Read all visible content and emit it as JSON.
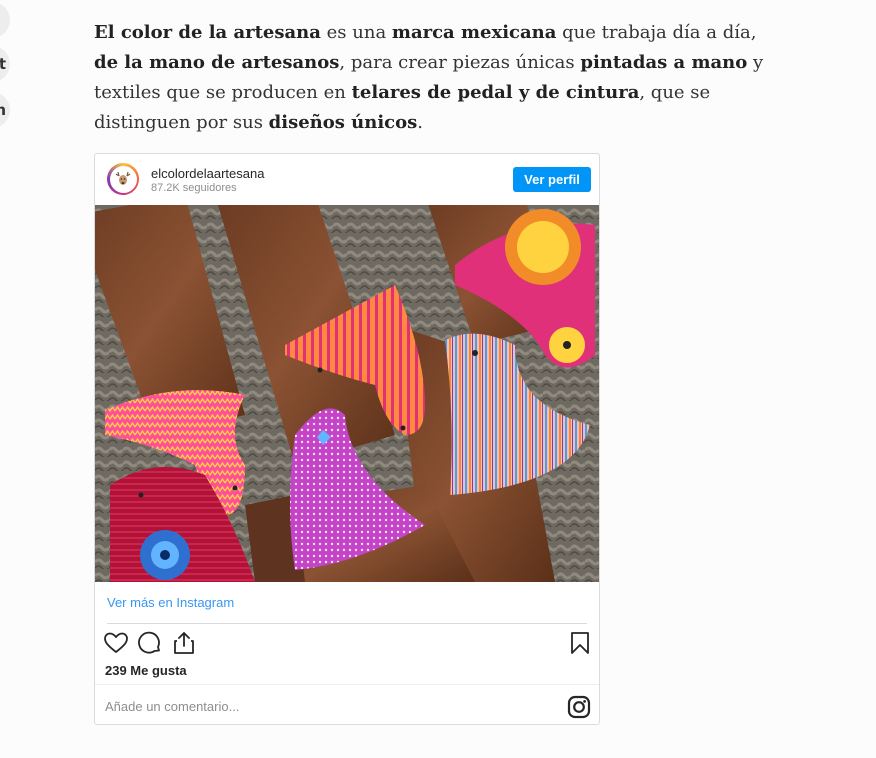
{
  "side_buttons": [
    "",
    "t",
    "n"
  ],
  "intro": {
    "p1": "El color de la artesana",
    "p2": " es una ",
    "p3": "marca mexicana",
    "p4": " que trabaja día a día, ",
    "p5": "de la mano de artesanos",
    "p6": ", para crear piezas únicas ",
    "p7": "pintadas a mano",
    "p8": " y textiles que se producen en ",
    "p9": "telares de pedal y de cintura",
    "p10": ", que se distinguen por sus ",
    "p11": "diseños únicos",
    "p12": "."
  },
  "instagram": {
    "username": "elcolordelaartesana",
    "followers": "87.2K seguidores",
    "profile_button": "Ver perfil",
    "view_more": "Ver más en Instagram",
    "likes": "239 Me gusta",
    "comment_placeholder": "Añade un comentario...",
    "brand_color": "#0095f6",
    "icons": [
      "heart-icon",
      "comment-icon",
      "share-icon",
      "bookmark-icon",
      "instagram-logo-icon"
    ]
  }
}
